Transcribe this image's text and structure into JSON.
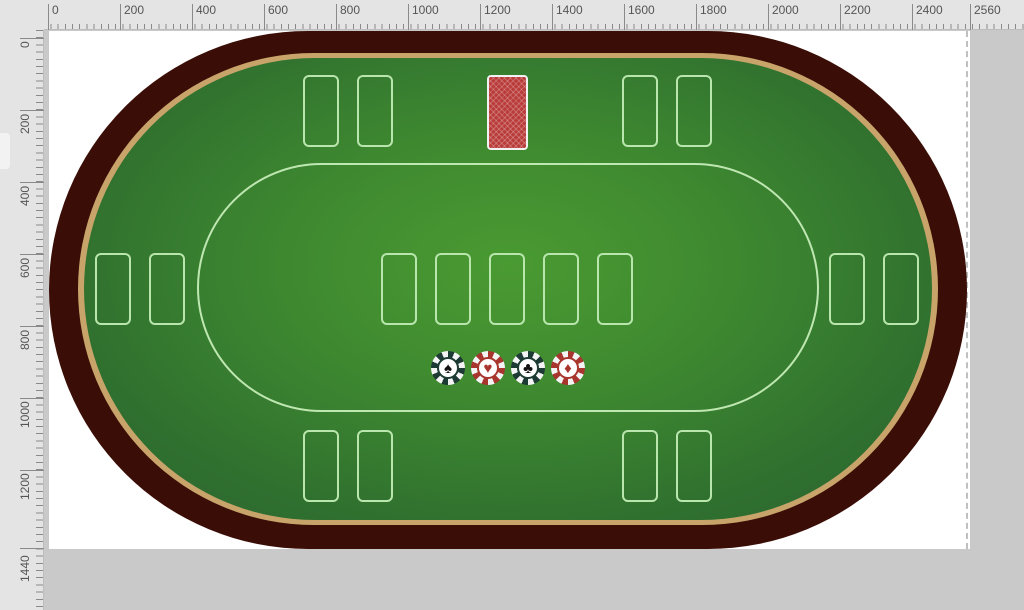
{
  "ruler": {
    "x_labels": [
      "0",
      "200",
      "400",
      "600",
      "800",
      "1000",
      "1200",
      "1400",
      "1600",
      "1800",
      "2000",
      "2200",
      "2400",
      "2560"
    ],
    "y_labels": [
      "0",
      "200",
      "400",
      "600",
      "800",
      "1000",
      "1200",
      "1440"
    ]
  },
  "table": {
    "felt_color": "#3f8a30",
    "rail_color": "#3a0e07",
    "trim_color": "#c9a46a",
    "line_color": "#bfe7b2"
  },
  "deck": {
    "icon": "card-back-icon",
    "color": "#b93c3a"
  },
  "chips": [
    {
      "suit": "♠",
      "name": "spade-chip",
      "ring": "#1d3b34",
      "glyph": "#111111"
    },
    {
      "suit": "♥",
      "name": "heart-chip",
      "ring": "#a8362e",
      "glyph": "#a8362e"
    },
    {
      "suit": "♣",
      "name": "club-chip",
      "ring": "#1d3b34",
      "glyph": "#111111"
    },
    {
      "suit": "♦",
      "name": "diamond-chip",
      "ring": "#a8362e",
      "glyph": "#a8362e"
    }
  ]
}
